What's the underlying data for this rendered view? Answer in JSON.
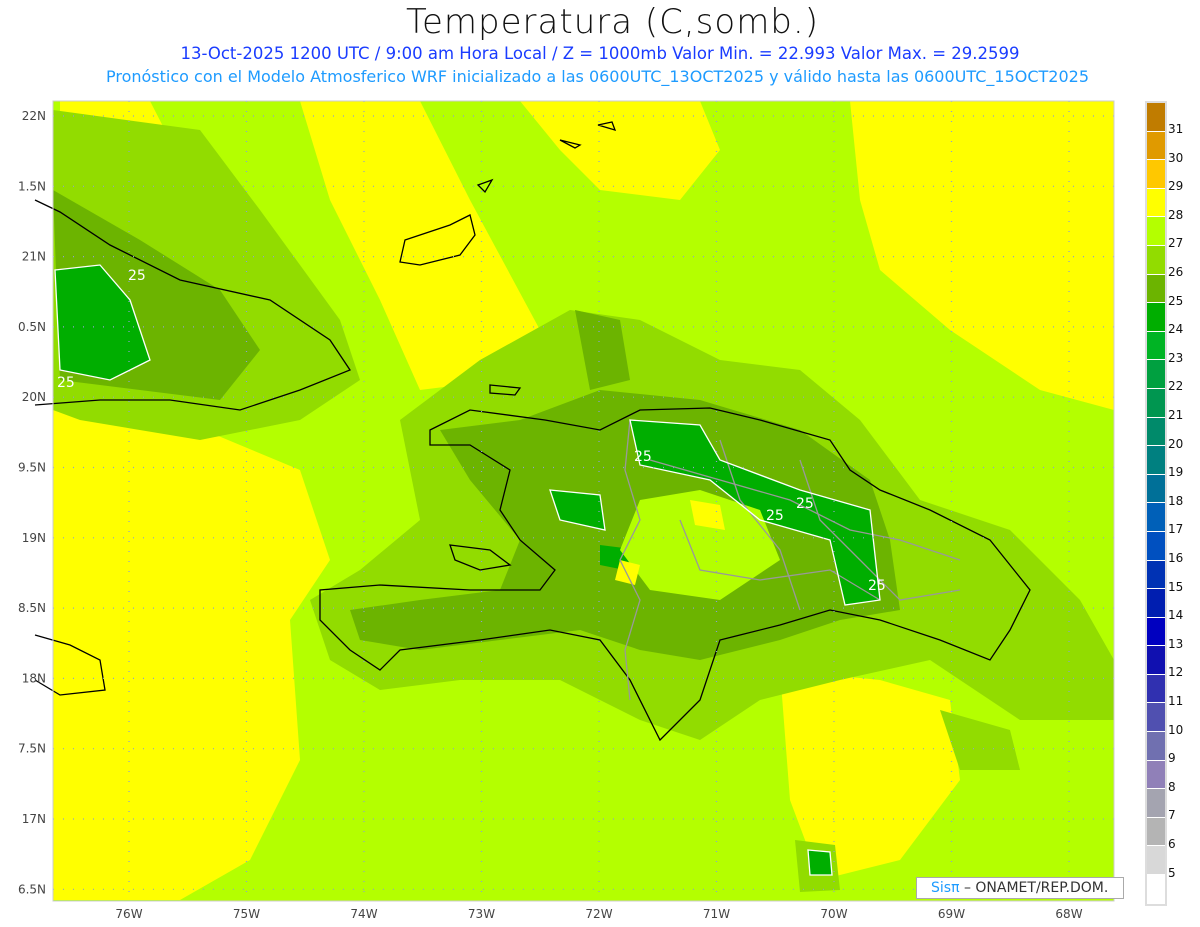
{
  "header": {
    "title": "Temperatura (C,somb.)",
    "line1": "13-Oct-2025  1200 UTC / 9:00 am Hora Local / Z = 1000mb    Valor Min. = 22.993  Valor Max. = 29.2599",
    "line2": "Pronóstico con el Modelo Atmosferico WRF inicializado a las 0600UTC_13OCT2025 y válido hasta las  0600UTC_15OCT2025"
  },
  "axes": {
    "lat_labels": [
      "22N",
      "1.5N",
      "21N",
      "0.5N",
      "20N",
      "9.5N",
      "19N",
      "8.5N",
      "18N",
      "7.5N",
      "17N",
      "6.5N"
    ],
    "lon_labels": [
      "76W",
      "75W",
      "74W",
      "73W",
      "72W",
      "71W",
      "70W",
      "69W",
      "68W"
    ]
  },
  "contour_labels": [
    "25",
    "25",
    "25",
    "25",
    "25",
    "25"
  ],
  "colorbar": {
    "labels": [
      "31",
      "30",
      "29",
      "28",
      "27",
      "26",
      "25",
      "24",
      "23",
      "22",
      "21",
      "20",
      "19",
      "18",
      "17",
      "16",
      "15",
      "14",
      "13",
      "12",
      "11",
      "10",
      "9",
      "8",
      "7",
      "6",
      "5"
    ],
    "colors": [
      "#c07c00",
      "#e09a00",
      "#ffc800",
      "#ffff00",
      "#b4ff00",
      "#92dc00",
      "#6cb400",
      "#00ae00",
      "#00b424",
      "#00a040",
      "#009650",
      "#008a6a",
      "#008080",
      "#007098",
      "#0060b8",
      "#0050c0",
      "#0032b4",
      "#001eb0",
      "#0000c0",
      "#1010b0",
      "#3030b0",
      "#5050b0",
      "#7070b0",
      "#9080b8",
      "#a4a4b0",
      "#b4b4b4",
      "#d8d8d8",
      "#ffffff"
    ]
  },
  "logo": {
    "brand": "Sisπ",
    "text": "– ONAMET/REP.DOM."
  }
}
